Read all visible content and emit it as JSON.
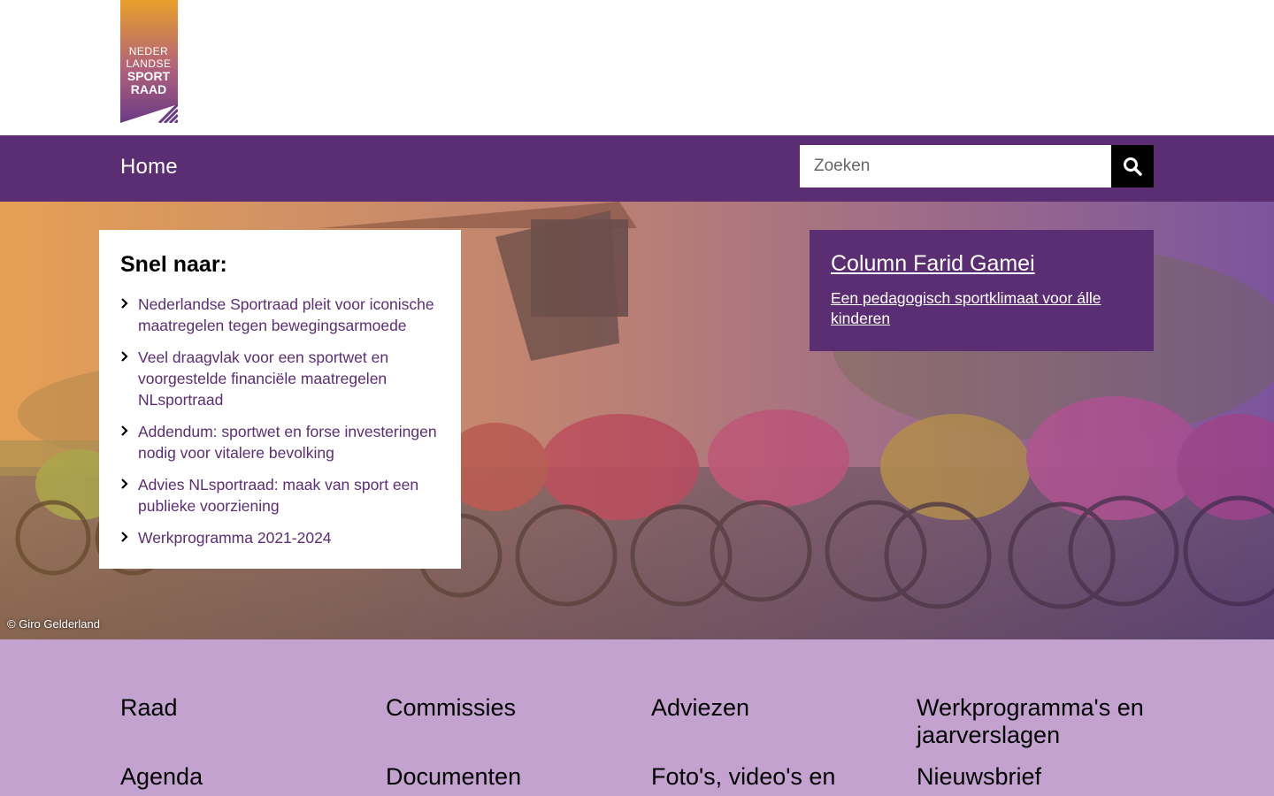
{
  "brand": {
    "logo_alt": "Nederlandse Sportraad",
    "logo_lines": [
      "NEDER",
      "LANDSE",
      "SPORT",
      "RAAD"
    ]
  },
  "nav": {
    "home_label": "Home"
  },
  "search": {
    "placeholder": "Zoeken",
    "icon": "search-icon"
  },
  "hero": {
    "photo_credit": "© Giro Gelderland"
  },
  "quick_links": {
    "title": "Snel naar:",
    "items": [
      {
        "label": "Nederlandse Sportraad pleit voor iconische maatregelen tegen bewegingsarmoede"
      },
      {
        "label": "Veel draagvlak voor een sportwet en voorgestelde financiële maatregelen NLsportraad"
      },
      {
        "label": "Addendum: sportwet en forse investeringen nodig voor vitalere bevolking"
      },
      {
        "label": "Advies NLsportraad: maak van sport een publieke voorziening"
      },
      {
        "label": "Werkprogramma 2021-2024"
      }
    ]
  },
  "column": {
    "title": "Column Farid Gamei",
    "subtitle": "Een pedagogisch sportklimaat voor álle kinderen"
  },
  "footer": {
    "links": [
      {
        "label": "Raad"
      },
      {
        "label": "Commissies"
      },
      {
        "label": "Adviezen"
      },
      {
        "label": "Werkprogramma's en jaarverslagen"
      },
      {
        "label": "Agenda"
      },
      {
        "label": "Documenten"
      },
      {
        "label": "Foto's, video's en"
      },
      {
        "label": "Nieuwsbrief"
      }
    ]
  },
  "colors": {
    "brand_purple": "#5b2e74",
    "footer_lilac": "#c4a2d0",
    "logo_orange": "#e8a02a"
  }
}
